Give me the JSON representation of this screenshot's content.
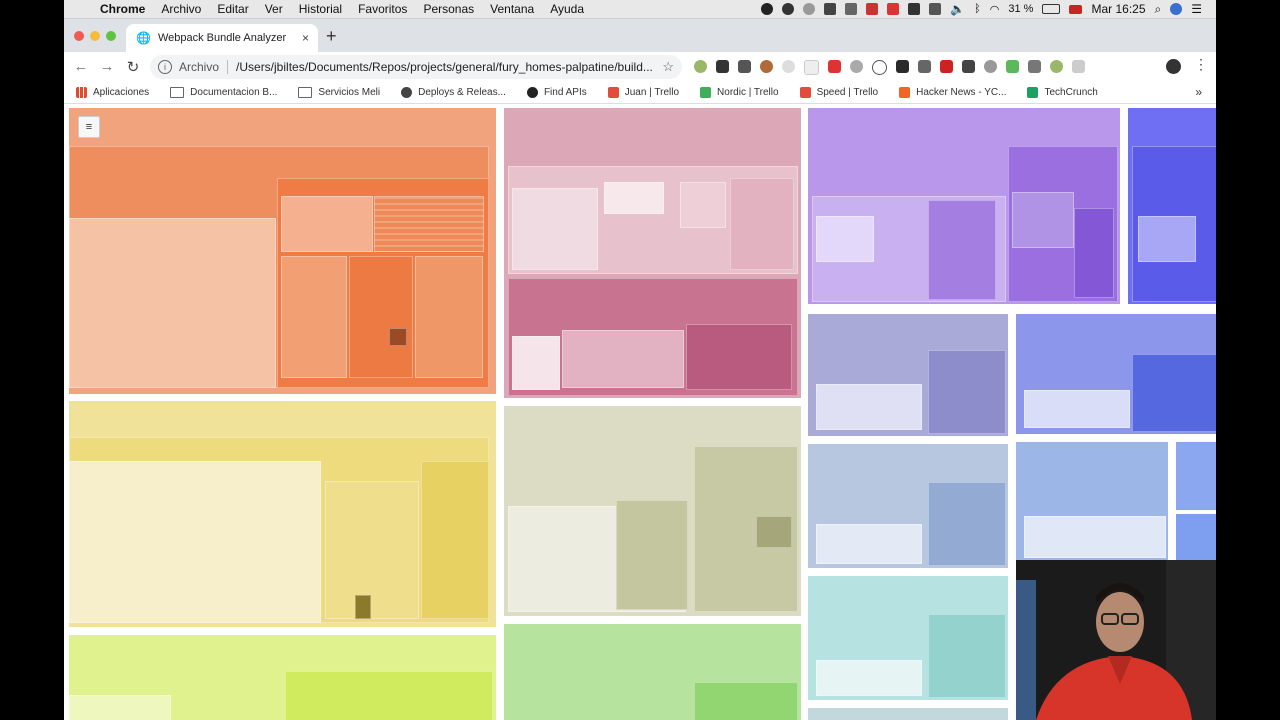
{
  "menubar": {
    "apple_glyph": "",
    "items": [
      "Chrome",
      "Archivo",
      "Editar",
      "Ver",
      "Historial",
      "Favoritos",
      "Personas",
      "Ventana",
      "Ayuda"
    ],
    "battery": "31 %",
    "clock": "Mar 16:25"
  },
  "browser": {
    "tab_title": "Webpack Bundle Analyzer",
    "new_tab": "+",
    "close_tab": "×",
    "omnibox_scheme": "Archivo",
    "omnibox_url": "/Users/jbiltes/Documents/Repos/projects/general/fury_homes-palpatine/build...",
    "back": "←",
    "forward": "→",
    "reload": "↻",
    "star": "☆",
    "menu": "⋮"
  },
  "bookmarks": [
    {
      "label": "Aplicaciones",
      "icon": "apps-grid-icon",
      "color": "#e04a2f"
    },
    {
      "label": "Documentacion B...",
      "icon": "folder-icon",
      "color": "#666666"
    },
    {
      "label": "Servicios Meli",
      "icon": "folder-icon",
      "color": "#666666"
    },
    {
      "label": "Deploys & Releas...",
      "icon": "globe-icon",
      "color": "#444444"
    },
    {
      "label": "Find APIs",
      "icon": "github-icon",
      "color": "#222222"
    },
    {
      "label": "Juan | Trello",
      "icon": "trello-icon",
      "color": "#e34b3b"
    },
    {
      "label": "Nordic | Trello",
      "icon": "trello-icon",
      "color": "#3fae5a"
    },
    {
      "label": "Speed | Trello",
      "icon": "trello-icon",
      "color": "#e34b3b"
    },
    {
      "label": "Hacker News - YC...",
      "icon": "ycombinator-icon",
      "color": "#f26522"
    },
    {
      "label": "TechCrunch",
      "icon": "techcrunch-icon",
      "color": "#1aa260"
    }
  ],
  "bookmarks_more": "»",
  "sidebar_toggle": "≡",
  "colors": {
    "orange": "#ee8a5a",
    "pink": "#d48aa3",
    "purple": "#a57ee2",
    "blue": "#6a6ef0",
    "yellow": "#ead360",
    "sage": "#c9caa6",
    "lavender": "#9a9ad2",
    "periwinkle": "#7d88e6",
    "steel": "#9db2d6",
    "cornflower": "#8aa7e3",
    "teal": "#9ad6d3",
    "lime": "#d6ee6a",
    "green": "#a8dc8a"
  }
}
